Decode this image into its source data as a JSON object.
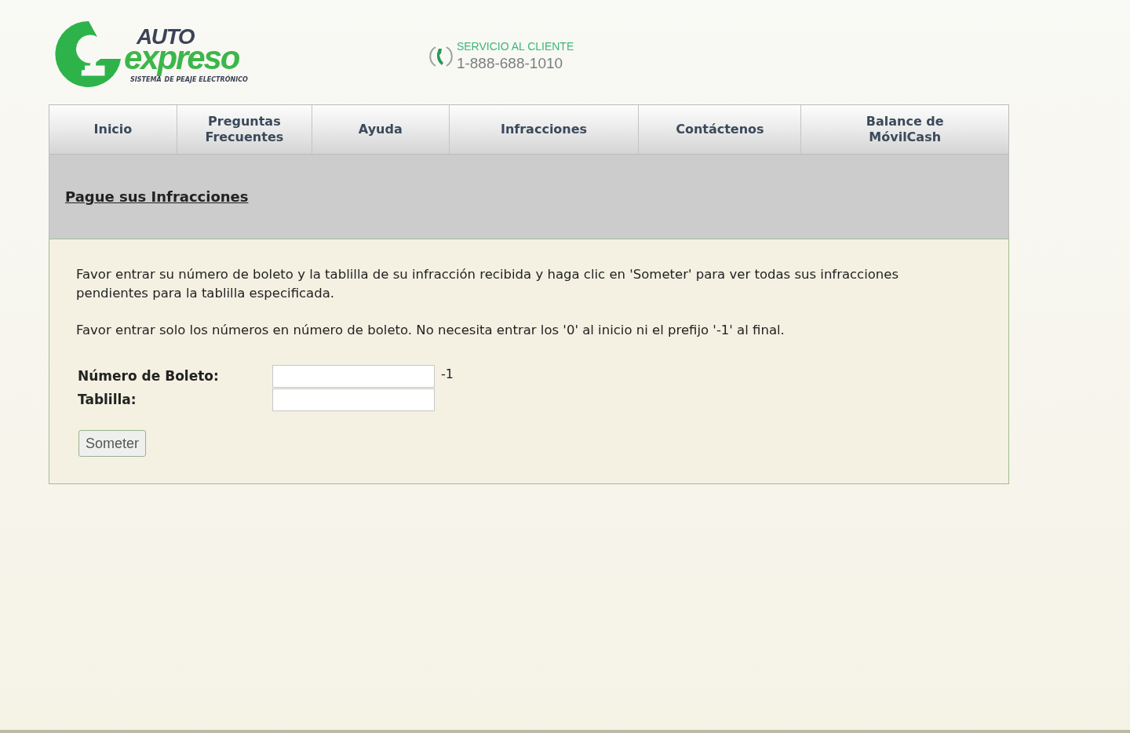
{
  "logo": {
    "word_1": "AUTO",
    "word_2": "expreso",
    "tagline_1": "SISTEMA",
    "tagline_2": "DE PEAJE ELECTRÓNICO"
  },
  "customer_service": {
    "label": "SERVICIO AL CLIENTE",
    "phone": "1-888-688-1010"
  },
  "nav": [
    {
      "label": "Inicio"
    },
    {
      "label": "Preguntas Frecuentes"
    },
    {
      "label": "Ayuda"
    },
    {
      "label": "Infracciones"
    },
    {
      "label": "Contáctenos"
    },
    {
      "label": "Balance de MóvilCash"
    }
  ],
  "section_title": "Pague sus Infracciones",
  "paragraphs": [
    "Favor entrar su número de boleto y la tablilla de su infracción recibida y haga clic en 'Someter' para ver todas sus infracciones pendientes para la tablilla especificada.",
    "Favor entrar solo los números en número de boleto. No necesita entrar los '0' al inicio ni el prefijo '-1' al final."
  ],
  "form": {
    "fields": [
      {
        "label": "Número de Boleto:",
        "suffix": "-1"
      },
      {
        "label": "Tablilla:"
      }
    ],
    "submit": "Someter"
  }
}
